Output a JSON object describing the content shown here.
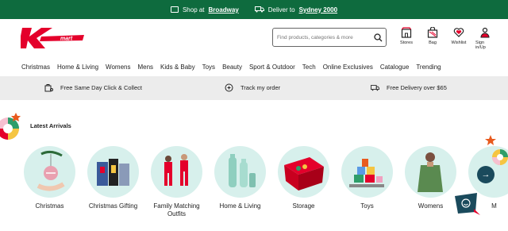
{
  "topbar": {
    "shop_prefix": "Shop at",
    "shop_store": "Broadway",
    "deliver_prefix": "Deliver to",
    "deliver_location": "Sydney 2000"
  },
  "search": {
    "placeholder": "Find products, categories & more"
  },
  "actions": [
    {
      "label": "Stores",
      "icon": "store-icon"
    },
    {
      "label": "Bag",
      "icon": "bag-icon"
    },
    {
      "label": "Wishlist",
      "icon": "heart-icon"
    },
    {
      "label": "Sign in/Up",
      "icon": "user-icon"
    }
  ],
  "nav": [
    "Christmas",
    "Home & Living",
    "Womens",
    "Mens",
    "Kids & Baby",
    "Toys",
    "Beauty",
    "Sport & Outdoor",
    "Tech",
    "Online Exclusives",
    "Catalogue",
    "Trending"
  ],
  "services": [
    {
      "label": "Free Same Day Click & Collect",
      "icon": "click-collect-icon"
    },
    {
      "label": "Track my order",
      "icon": "track-order-icon"
    },
    {
      "label": "Free Delivery over $65",
      "icon": "delivery-truck-icon"
    }
  ],
  "section_title": "Latest Arrivals",
  "categories": [
    {
      "label": "Christmas"
    },
    {
      "label": "Christmas Gifting"
    },
    {
      "label": "Family Matching Outfits"
    },
    {
      "label": "Home & Living"
    },
    {
      "label": "Storage"
    },
    {
      "label": "Toys"
    },
    {
      "label": "Womens"
    },
    {
      "label": "M"
    }
  ],
  "colors": {
    "topbar": "#0e6b3e",
    "brand_red": "#e4002b",
    "circle_bg": "#d7f0ec",
    "services_bg": "#ececec"
  }
}
